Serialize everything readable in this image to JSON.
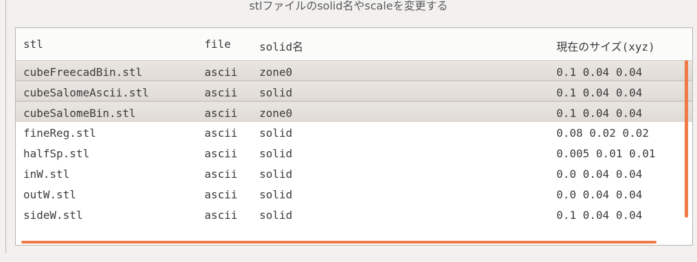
{
  "window": {
    "title": "stlファイルのsolid名やscaleを変更する"
  },
  "table": {
    "headers": {
      "stl": "stl",
      "file": "file",
      "solid": "solid名",
      "size": "現在のサイズ(xyz)"
    },
    "rows": [
      {
        "stl": "cubeFreecadBin.stl",
        "file": "ascii",
        "solid": "zone0",
        "size": "0.1 0.04 0.04",
        "selected": true
      },
      {
        "stl": "cubeSalomeAscii.stl",
        "file": "ascii",
        "solid": "solid",
        "size": "0.1 0.04 0.04",
        "selected": true
      },
      {
        "stl": "cubeSalomeBin.stl",
        "file": "ascii",
        "solid": "zone0",
        "size": "0.1 0.04 0.04",
        "selected": true
      },
      {
        "stl": "fineReg.stl",
        "file": "ascii",
        "solid": "solid",
        "size": "0.08 0.02 0.02",
        "selected": false
      },
      {
        "stl": "halfSp.stl",
        "file": "ascii",
        "solid": "solid",
        "size": "0.005 0.01 0.01",
        "selected": false
      },
      {
        "stl": "inW.stl",
        "file": "ascii",
        "solid": "solid",
        "size": "0.0 0.04 0.04",
        "selected": false
      },
      {
        "stl": "outW.stl",
        "file": "ascii",
        "solid": "solid",
        "size": "0.0 0.04 0.04",
        "selected": false
      },
      {
        "stl": "sideW.stl",
        "file": "ascii",
        "solid": "solid",
        "size": "0.1 0.04 0.04",
        "selected": false
      }
    ]
  },
  "colors": {
    "accent": "#f07a46",
    "selected_row": "#e5e0db"
  }
}
